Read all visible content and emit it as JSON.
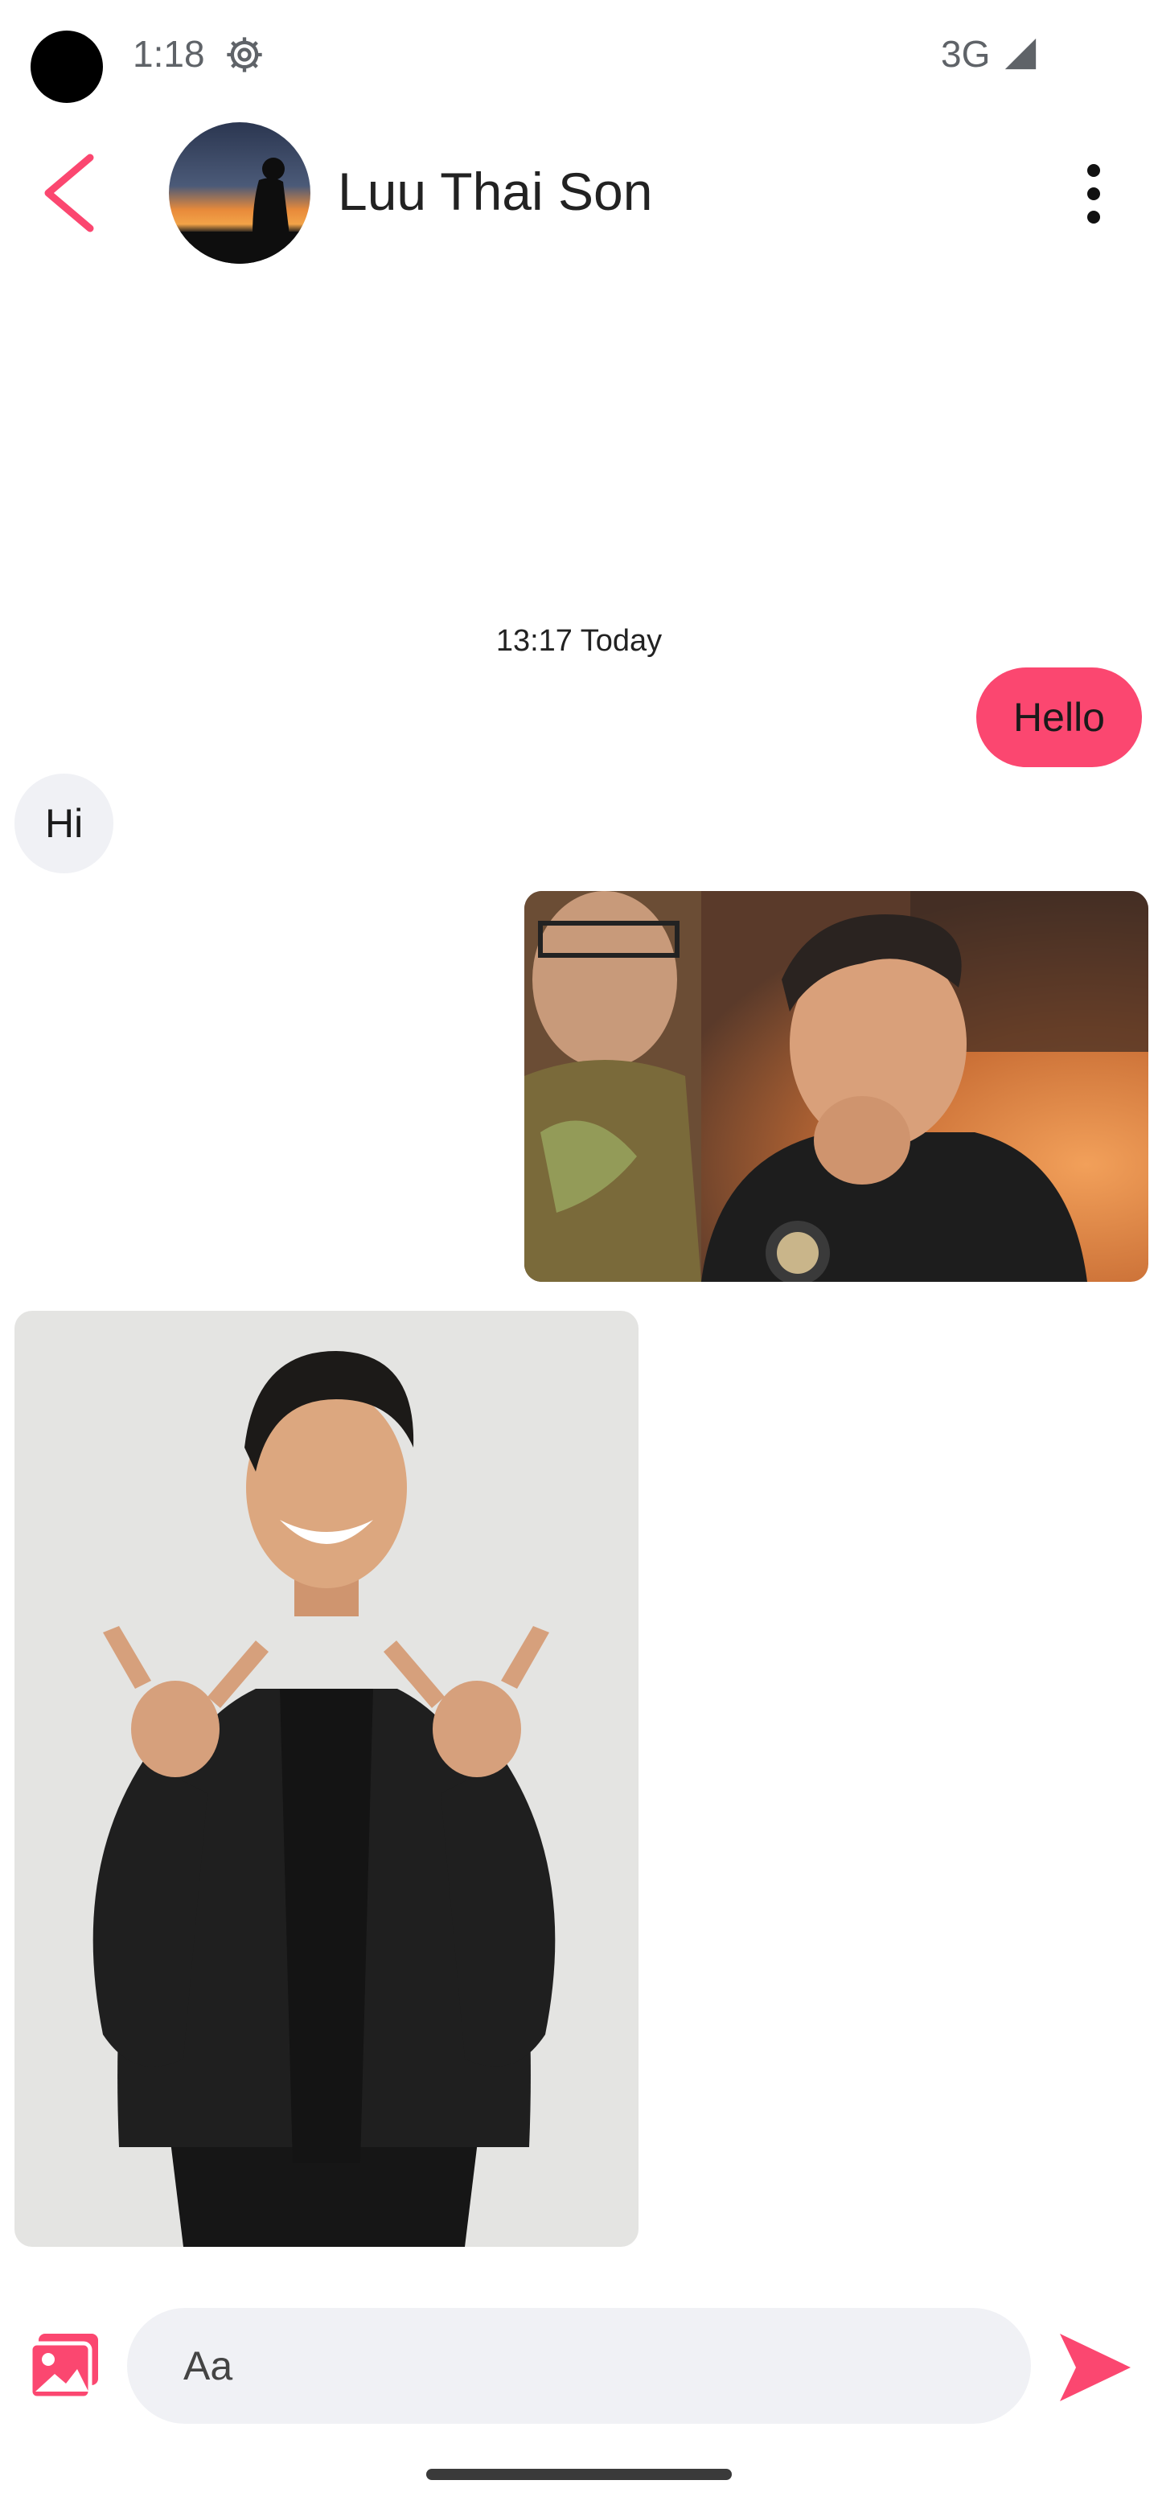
{
  "status_bar": {
    "time": "1:18",
    "network": "3G",
    "icons": [
      "settings-gear-icon",
      "cellular-signal-icon"
    ]
  },
  "header": {
    "contact_name": "Luu Thai Son",
    "back_icon": "chevron-left-icon",
    "menu_icon": "more-vertical-icon"
  },
  "conversation": {
    "timestamp": "13:17 Today",
    "messages": [
      {
        "direction": "outgoing",
        "type": "text",
        "text": "Hello"
      },
      {
        "direction": "incoming",
        "type": "text",
        "text": "Hi"
      },
      {
        "direction": "outgoing",
        "type": "image"
      },
      {
        "direction": "incoming",
        "type": "image"
      }
    ]
  },
  "composer": {
    "placeholder": "Aa",
    "gallery_icon": "image-gallery-icon",
    "send_icon": "send-icon"
  },
  "colors": {
    "accent": "#fb4770",
    "incoming_bubble": "#f0f1f5",
    "status_text": "#5f6368"
  }
}
